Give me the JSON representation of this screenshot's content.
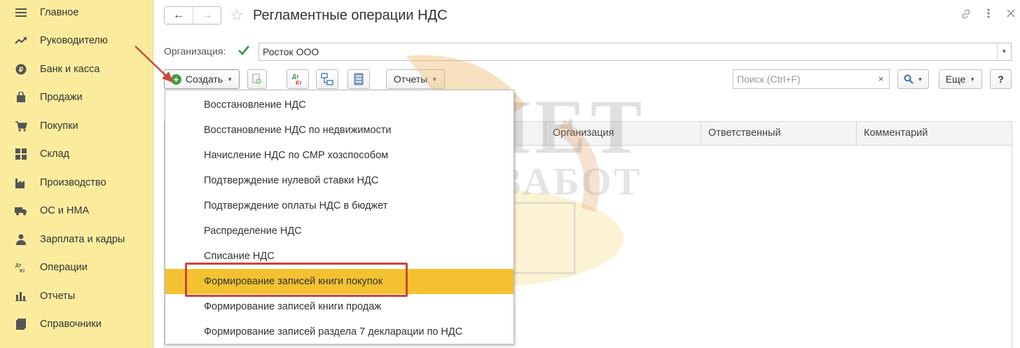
{
  "sidebar": {
    "items": [
      {
        "label": "Главное",
        "icon": "menu-lines-icon"
      },
      {
        "label": "Руководителю",
        "icon": "trend-up-icon"
      },
      {
        "label": "Банк и касса",
        "icon": "coin-icon"
      },
      {
        "label": "Продажи",
        "icon": "shopping-bag-icon"
      },
      {
        "label": "Покупки",
        "icon": "cart-icon"
      },
      {
        "label": "Склад",
        "icon": "warehouse-icon"
      },
      {
        "label": "Производство",
        "icon": "factory-icon"
      },
      {
        "label": "ОС и НМА",
        "icon": "truck-icon"
      },
      {
        "label": "Зарплата и кадры",
        "icon": "person-icon"
      },
      {
        "label": "Операции",
        "icon": "dt-kt-icon"
      },
      {
        "label": "Отчеты",
        "icon": "bar-chart-icon"
      },
      {
        "label": "Справочники",
        "icon": "book-icon"
      }
    ]
  },
  "header": {
    "title": "Регламентные операции НДС",
    "back_icon": "←",
    "forward_icon": "→",
    "star_icon": "☆"
  },
  "organization": {
    "label": "Организация:",
    "value": "Росток ООО"
  },
  "toolbar": {
    "create_label": "Создать",
    "reports_label": "Отчеты",
    "more_label": "Еще",
    "help_label": "?",
    "dtkt_top": "Дт",
    "dtkt_bottom": "Кт"
  },
  "search": {
    "placeholder": "Поиск (Ctrl+F)",
    "clear_label": "×"
  },
  "table": {
    "columns": [
      "Организация",
      "Ответственный",
      "Комментарий"
    ]
  },
  "create_menu": {
    "items": [
      "Восстановление НДС",
      "Восстановление НДС по недвижимости",
      "Начисление НДС по СМР хозспособом",
      "Подтверждение нулевой ставки НДС",
      "Подтверждение оплаты НДС в бюджет",
      "Распределение НДС",
      "Списание НДС",
      "Формирование записей книги покупок",
      "Формирование записей книги продаж",
      "Формирование записей раздела 7 декларации по НДС"
    ],
    "active_index": 7
  },
  "watermark": {
    "line1": "УЧЕТ",
    "line2": "БЕЗ ЗАБОТ"
  },
  "colors": {
    "sidebar_bg": "#fbec9d",
    "active_item": "#f4c230",
    "highlight_border": "#c8453a",
    "checkbox": "#2f9a3c"
  }
}
